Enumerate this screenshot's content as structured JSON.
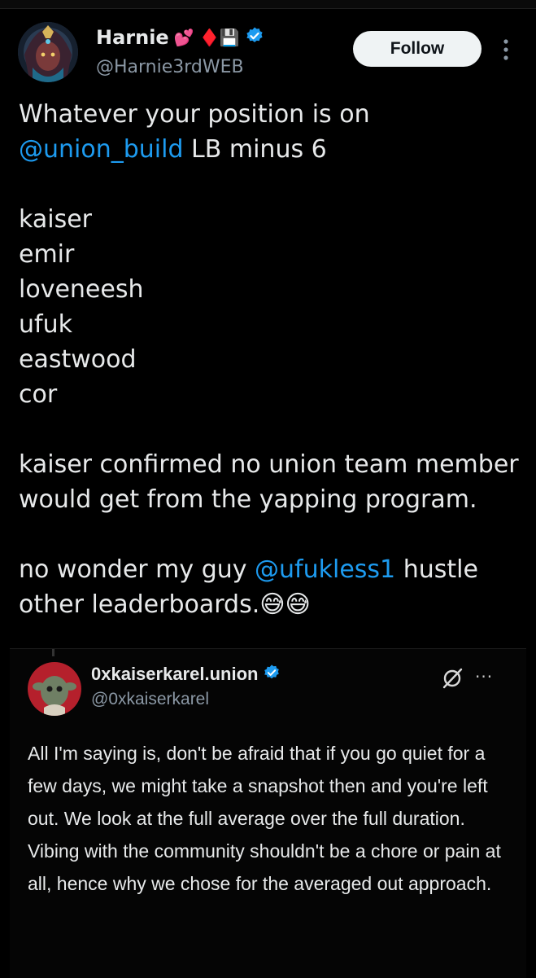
{
  "tweet": {
    "author": {
      "display_name": "Harnie",
      "badges": "💕 ♦️💾",
      "handle": "@Harnie3rdWEB",
      "verified": true
    },
    "follow_label": "Follow",
    "text_line1": "Whatever your position is on",
    "mention1": "@union_build",
    "text_line2_rest": " LB minus 6",
    "list": "kaiser\nemir\nloveneesh\nufuk\neastwood\ncor",
    "para2": "kaiser confirmed no union team member would get from the yapping program.",
    "para3_start": "no wonder my guy ",
    "mention2": "@ufukless1",
    "para3_end": " hustle other leaderboards.😅😅"
  },
  "quote": {
    "display_name": "0xkaiserkarel.union",
    "handle": "@0xkaiserkarel",
    "verified": true,
    "more_label": "···",
    "text": "All I'm saying is, don't be afraid that if you go quiet for a few days, we might take a snapshot then and you're left out. We look at the full average over the full duration.\nVibing with the community shouldn't be a chore or pain at all, hence why we chose for the averaged out approach."
  },
  "colors": {
    "background": "#000000",
    "text": "#e7e9ea",
    "secondary": "#8b98a5",
    "mention": "#1d9bf0",
    "verified": "#1d9bf0",
    "follow_bg": "#eff3f4"
  },
  "icons": {
    "verified": "verified-badge-icon",
    "more": "more-vertical-icon",
    "grok": "grok-icon"
  }
}
